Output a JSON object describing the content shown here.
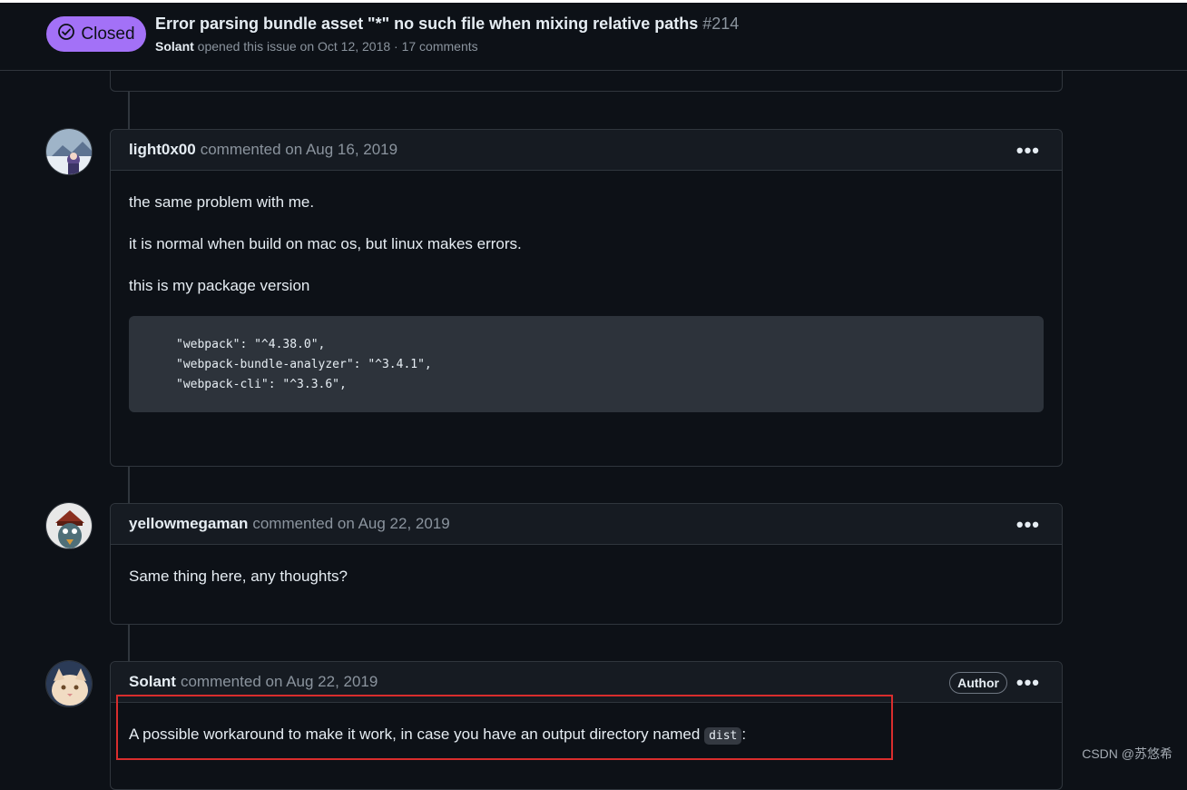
{
  "issue": {
    "state": "Closed",
    "title": "Error parsing bundle asset \"*\" no such file when mixing relative paths",
    "number": "#214",
    "author": "Solant",
    "meta_text": "opened this issue on Oct 12, 2018 · 17 comments"
  },
  "comments": [
    {
      "author": "light0x00",
      "action": "commented on Aug 16, 2019",
      "paragraphs": [
        "the same problem with me.",
        "it is normal when build on mac os, but linux makes errors.",
        "this is my package version"
      ],
      "code": "\"webpack\": \"^4.38.0\",\n\"webpack-bundle-analyzer\": \"^3.4.1\",\n\"webpack-cli\": \"^3.3.6\","
    },
    {
      "author": "yellowmegaman",
      "action": "commented on Aug 22, 2019",
      "paragraphs": [
        "Same thing here, any thoughts?"
      ]
    },
    {
      "author": "Solant",
      "action": "commented on Aug 22, 2019",
      "badge": "Author",
      "paragraphs_before_code": "A possible workaround to make it work, in case you have an output directory named",
      "inline_code": "dist",
      "paragraph_after_code": ":"
    }
  ],
  "icons": {
    "state": "check-circle-icon",
    "more": "kebab-horizontal-icon"
  },
  "more_label": "•••",
  "watermark": "CSDN @苏悠希",
  "colors": {
    "closed_badge": "#a371f7",
    "highlight": "#d92d2d",
    "background": "#0d1117"
  }
}
